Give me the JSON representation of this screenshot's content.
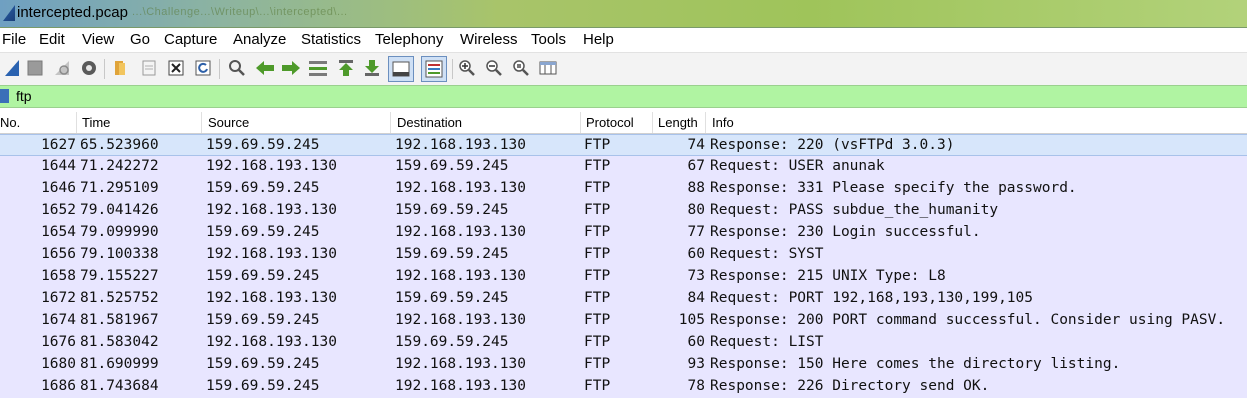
{
  "window": {
    "title": "intercepted.pcap",
    "faint_path": "...\\Challenge...\\Writeup\\...\\intercepted\\..."
  },
  "menu": [
    "File",
    "Edit",
    "View",
    "Go",
    "Capture",
    "Analyze",
    "Statistics",
    "Telephony",
    "Wireless",
    "Tools",
    "Help"
  ],
  "toolbar": {
    "icons": [
      "shark-fin-start-icon",
      "stop-icon",
      "restart-icon",
      "capture-options-icon",
      "open-file-icon",
      "save-file-icon",
      "close-file-icon",
      "reload-icon",
      "find-packet-icon",
      "back-icon",
      "forward-icon",
      "go-to-packet-icon",
      "first-packet-icon",
      "last-packet-icon",
      "auto-scroll-icon",
      "colorize-icon",
      "zoom-in-icon",
      "zoom-out-icon",
      "normal-size-icon",
      "resize-columns-icon"
    ]
  },
  "filter": {
    "value": "ftp"
  },
  "columns": [
    "No.",
    "Time",
    "Source",
    "Destination",
    "Protocol",
    "Length",
    "Info"
  ],
  "packets": [
    {
      "no": "1627",
      "time": "65.523960",
      "src": "159.69.59.245",
      "dst": "192.168.193.130",
      "proto": "FTP",
      "len": "74",
      "info": "Response: 220 (vsFTPd 3.0.3)"
    },
    {
      "no": "1644",
      "time": "71.242272",
      "src": "192.168.193.130",
      "dst": "159.69.59.245",
      "proto": "FTP",
      "len": "67",
      "info": "Request: USER anunak"
    },
    {
      "no": "1646",
      "time": "71.295109",
      "src": "159.69.59.245",
      "dst": "192.168.193.130",
      "proto": "FTP",
      "len": "88",
      "info": "Response: 331 Please specify the password."
    },
    {
      "no": "1652",
      "time": "79.041426",
      "src": "192.168.193.130",
      "dst": "159.69.59.245",
      "proto": "FTP",
      "len": "80",
      "info": "Request: PASS subdue_the_humanity"
    },
    {
      "no": "1654",
      "time": "79.099990",
      "src": "159.69.59.245",
      "dst": "192.168.193.130",
      "proto": "FTP",
      "len": "77",
      "info": "Response: 230 Login successful."
    },
    {
      "no": "1656",
      "time": "79.100338",
      "src": "192.168.193.130",
      "dst": "159.69.59.245",
      "proto": "FTP",
      "len": "60",
      "info": "Request: SYST"
    },
    {
      "no": "1658",
      "time": "79.155227",
      "src": "159.69.59.245",
      "dst": "192.168.193.130",
      "proto": "FTP",
      "len": "73",
      "info": "Response: 215 UNIX Type: L8"
    },
    {
      "no": "1672",
      "time": "81.525752",
      "src": "192.168.193.130",
      "dst": "159.69.59.245",
      "proto": "FTP",
      "len": "84",
      "info": "Request: PORT 192,168,193,130,199,105"
    },
    {
      "no": "1674",
      "time": "81.581967",
      "src": "159.69.59.245",
      "dst": "192.168.193.130",
      "proto": "FTP",
      "len": "105",
      "info": "Response: 200 PORT command successful. Consider using PASV."
    },
    {
      "no": "1676",
      "time": "81.583042",
      "src": "192.168.193.130",
      "dst": "159.69.59.245",
      "proto": "FTP",
      "len": "60",
      "info": "Request: LIST"
    },
    {
      "no": "1680",
      "time": "81.690999",
      "src": "159.69.59.245",
      "dst": "192.168.193.130",
      "proto": "FTP",
      "len": "93",
      "info": "Response: 150 Here comes the directory listing."
    },
    {
      "no": "1686",
      "time": "81.743684",
      "src": "159.69.59.245",
      "dst": "192.168.193.130",
      "proto": "FTP",
      "len": "78",
      "info": "Response: 226 Directory send OK."
    }
  ],
  "colors": {
    "row_bg": "#e8e6ff",
    "selected_bg": "#d7e6fb",
    "filter_bg": "#b0f4a2"
  }
}
